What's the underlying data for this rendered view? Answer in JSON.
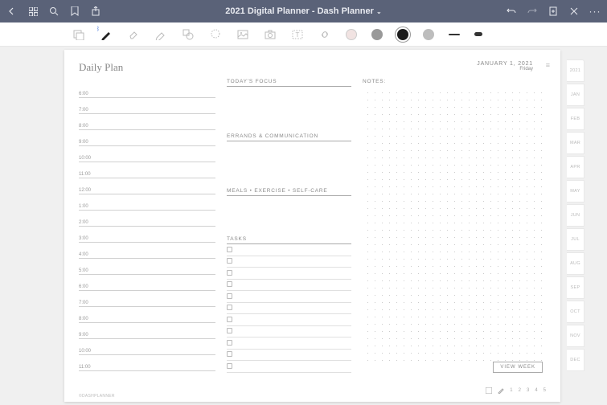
{
  "header": {
    "title": "2021 Digital Planner - Dash Planner"
  },
  "page": {
    "title": "Daily Plan",
    "date_line1": "JANUARY 1, 2021",
    "date_line2": "Friday",
    "watermark": "©DASHPLANNER"
  },
  "timeslots": [
    "6:00",
    "7:00",
    "8:00",
    "9:00",
    "10:00",
    "11:00",
    "12:00",
    "1:00",
    "2:00",
    "3:00",
    "4:00",
    "5:00",
    "6:00",
    "7:00",
    "8:00",
    "9:00",
    "10:00",
    "11:00"
  ],
  "sections": {
    "focus": "TODAY'S FOCUS",
    "errands": "ERRANDS & COMMUNICATION",
    "meals": "MEALS • EXERCISE • SELF-CARE",
    "tasks": "TASKS",
    "notes": "NOTES:"
  },
  "view_week": "VIEW WEEK",
  "footer_nums": [
    "1",
    "2",
    "3",
    "4",
    "5"
  ],
  "tabs": [
    "2021",
    "JAN",
    "FEB",
    "MAR",
    "APR",
    "MAY",
    "JUN",
    "JUL",
    "AUG",
    "SEP",
    "OCT",
    "NOV",
    "DEC"
  ],
  "colors": {
    "swatch1": "#f1e3e2",
    "swatch2": "#999999",
    "swatch3": "#1b1b1b",
    "swatch4": "#bdbdbd"
  }
}
